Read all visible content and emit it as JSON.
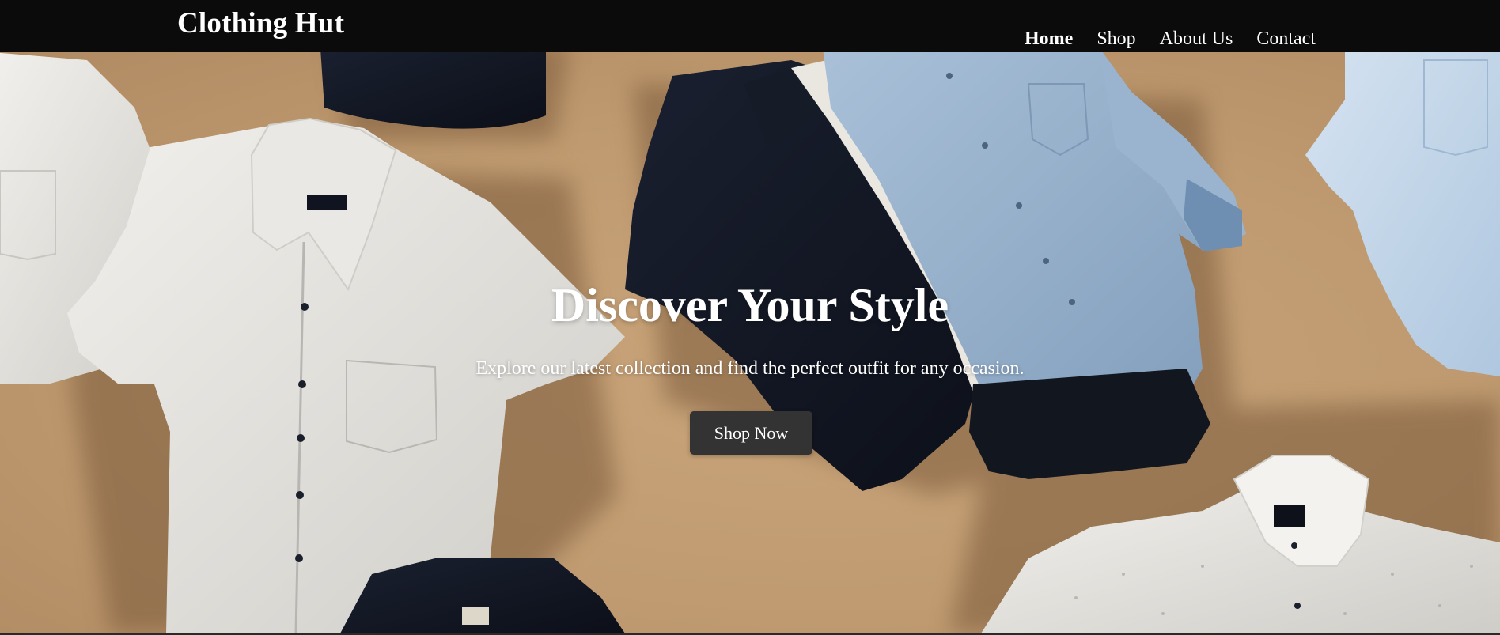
{
  "header": {
    "logo": "Clothing Hut",
    "nav": [
      {
        "label": "Home",
        "active": true
      },
      {
        "label": "Shop",
        "active": false
      },
      {
        "label": "About Us",
        "active": false
      },
      {
        "label": "Contact",
        "active": false
      }
    ]
  },
  "hero": {
    "title": "Discover Your Style",
    "subtitle": "Explore our latest collection and find the perfect outfit for any occasion.",
    "cta_label": "Shop Now",
    "background_image": "shirts-on-tan-background",
    "colors": {
      "header_bg": "#0b0b0b",
      "hero_bg": "#c19c74",
      "button_bg": "#333333",
      "text": "#ffffff"
    }
  }
}
